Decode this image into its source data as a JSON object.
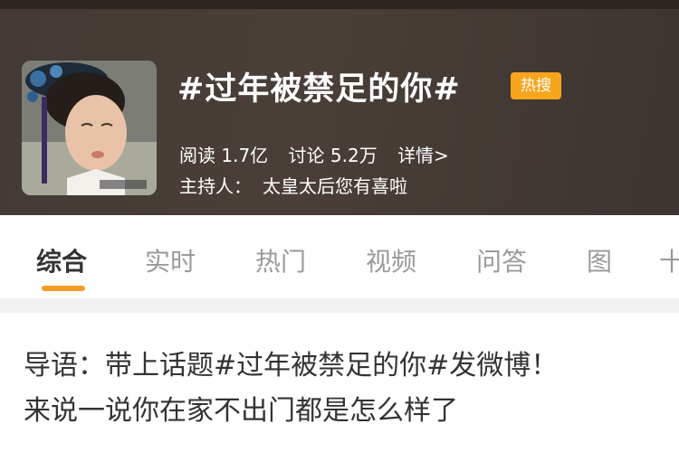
{
  "topic": {
    "title": "#过年被禁足的你#",
    "badge": "热搜",
    "stats": {
      "reads": "阅读 1.7亿",
      "discussions": "讨论 5.2万",
      "details_link": "详情>"
    },
    "host_label": "主持人：",
    "host_name": "太皇太后您有喜啦"
  },
  "tabs": [
    {
      "label": "综合",
      "active": true
    },
    {
      "label": "实时",
      "active": false
    },
    {
      "label": "热门",
      "active": false
    },
    {
      "label": "视频",
      "active": false
    },
    {
      "label": "问答",
      "active": false
    },
    {
      "label": "图",
      "active": false
    },
    {
      "label": "十",
      "active": false
    }
  ],
  "guide": {
    "line1": "导语：带上话题#过年被禁足的你#发微博！",
    "line2": "来说一说你在家不出门都是怎么样了"
  },
  "colors": {
    "header_bg": "#433a35",
    "badge": "#f7a51d",
    "active_underline": "#f59b22"
  }
}
